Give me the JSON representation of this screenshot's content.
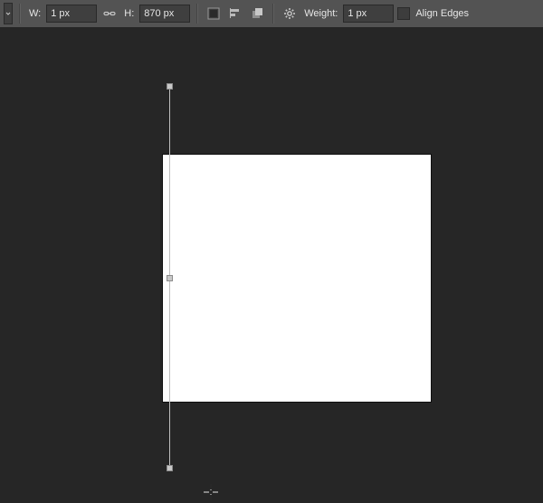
{
  "toolbar": {
    "width_label": "W:",
    "width_value": "1 px",
    "height_label": "H:",
    "height_value": "870 px",
    "weight_label": "Weight:",
    "weight_value": "1 px",
    "align_edges_label": "Align Edges",
    "align_edges_checked": false
  },
  "icons": {
    "link": "link-icon",
    "fill": "fill-swatch-icon",
    "align": "path-align-icon",
    "arrange": "path-arrange-icon",
    "gear": "gear-icon"
  },
  "canvas": {
    "artboard_color": "#ffffff",
    "shape": {
      "type": "line",
      "selected": true,
      "handles": 3
    }
  }
}
